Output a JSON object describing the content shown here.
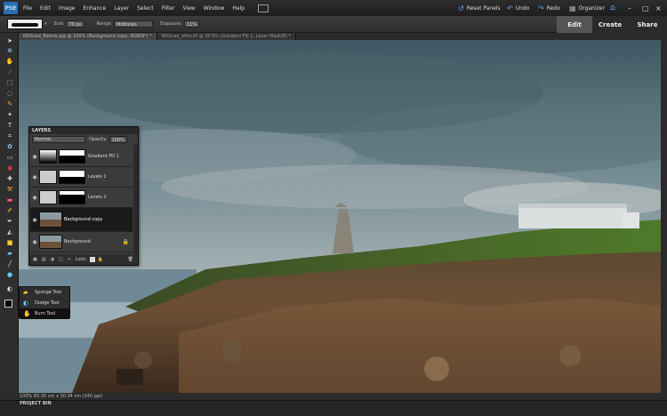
{
  "app": {
    "logo": "PSE"
  },
  "menu": [
    "File",
    "Edit",
    "Image",
    "Enhance",
    "Layer",
    "Select",
    "Filter",
    "View",
    "Window",
    "Help"
  ],
  "topbar": {
    "reset_panels": "Reset Panels",
    "undo": "Undo",
    "redo": "Redo",
    "organizer": "Organizer"
  },
  "options": {
    "size_label": "Size:",
    "size_value": "70 px",
    "range_label": "Range:",
    "range_value": "Midtones",
    "exposure_label": "Exposure:",
    "exposure_value": "11%"
  },
  "modes": {
    "edit": "Edit",
    "create": "Create",
    "share": "Share"
  },
  "tabs": [
    {
      "label": "NDGrad_Before.jpg @ 100% (Background copy, RGB/8*) *"
    },
    {
      "label": "NDGrad_after.tif @ 30.5% (Gradient Fill 1, Layer Mask/8) *"
    }
  ],
  "layers_panel": {
    "title": "LAYERS",
    "blend_mode": "Normal",
    "opacity_label": "Opacity:",
    "opacity_value": "100%",
    "lock_label": "Lock:",
    "layers": [
      {
        "name": "Gradient Fill 1"
      },
      {
        "name": "Levels 1"
      },
      {
        "name": "Levels 2"
      },
      {
        "name": "Background copy"
      },
      {
        "name": "Background"
      }
    ]
  },
  "tool_flyout": [
    {
      "label": "Sponge Tool"
    },
    {
      "label": "Dodge Tool"
    },
    {
      "label": "Burn Tool"
    }
  ],
  "status": {
    "text": "100%    85.35 cm x 30.34 cm (240 ppi)"
  },
  "project_bin": {
    "label": "PROJECT BIN"
  }
}
